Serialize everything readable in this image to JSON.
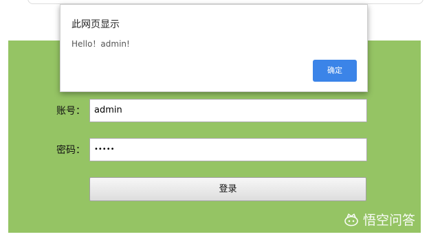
{
  "dialog": {
    "title": "此网页显示",
    "message": "Hello！admin!",
    "ok_label": "确定"
  },
  "form": {
    "username_label": "账号：",
    "username_value": "admin",
    "password_label": "密码：",
    "password_value": "•••••",
    "login_label": "登录"
  },
  "watermark": {
    "text": "悟空问答"
  },
  "colors": {
    "panel_green": "#95c464",
    "dialog_button_blue": "#3b84e8"
  }
}
